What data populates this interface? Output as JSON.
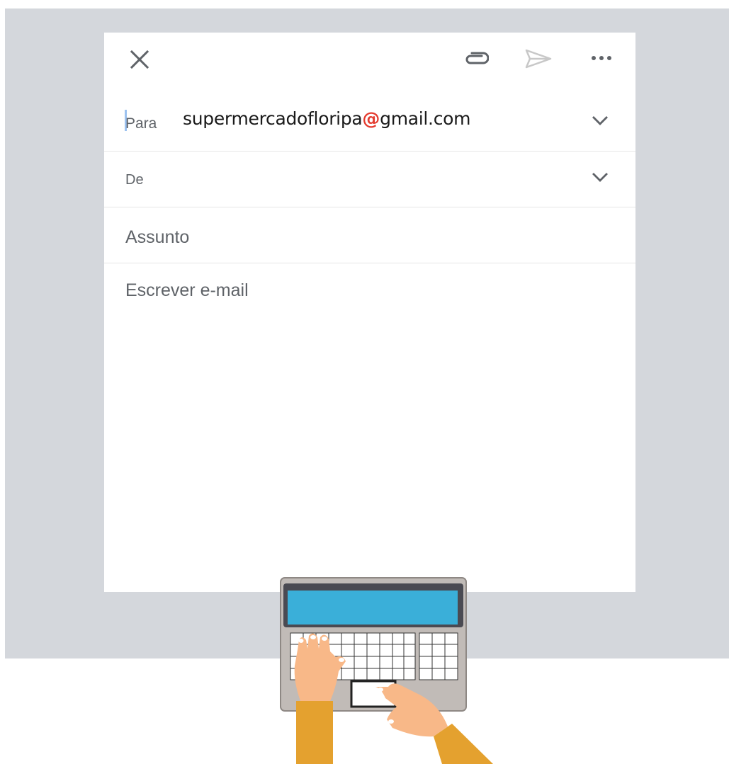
{
  "compose": {
    "toolbar": {
      "close_icon": "close-icon",
      "attach_icon": "paperclip-icon",
      "send_icon": "send-icon",
      "more_icon": "more-horizontal-icon"
    },
    "to": {
      "label": "Para",
      "value_local": "supermercadofloripa",
      "value_at": "@",
      "value_domain": "gmail.com"
    },
    "from": {
      "label": "De"
    },
    "subject": {
      "placeholder": "Assunto"
    },
    "body": {
      "placeholder": "Escrever e-mail"
    }
  },
  "colors": {
    "background_panel": "#d4d7dc",
    "compose_bg": "#ffffff",
    "at_sign": "#e43b2f",
    "label_gray": "#5f6368",
    "send_disabled": "#c8c8c8",
    "laptop_screen": "#3aafd9",
    "laptop_body": "#c1bbb7",
    "sleeve": "#e4a12f",
    "skin": "#f8b888"
  },
  "illustration": {
    "name": "laptop-typing-hands"
  }
}
